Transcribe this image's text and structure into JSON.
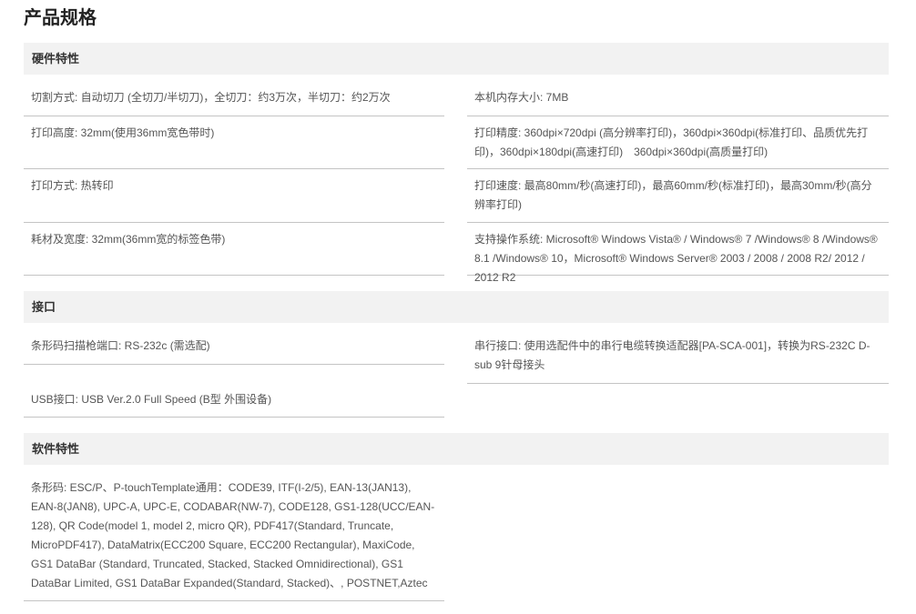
{
  "page_title": "产品规格",
  "sections": [
    {
      "title": "硬件特性",
      "left": [
        "切割方式: 自动切刀 (全切刀/半切刀)，全切刀：约3万次，半切刀：约2万次",
        "打印高度: 32mm(使用36mm宽色带时)",
        "打印方式: 热转印",
        "耗材及宽度: 32mm(36mm宽的标签色带)"
      ],
      "right": [
        "本机内存大小: 7MB",
        "打印精度: 360dpi×720dpi (高分辨率打印)，360dpi×360dpi(标准打印、品质优先打印)，360dpi×180dpi(高速打印)　360dpi×360dpi(高质量打印)",
        "打印速度: 最高80mm/秒(高速打印)，最高60mm/秒(标准打印)，最高30mm/秒(高分辨率打印)",
        "支持操作系统: Microsoft® Windows Vista® / Windows® 7 /Windows® 8 /Windows® 8.1 /Windows® 10，Microsoft® Windows Server® 2003 / 2008 / 2008 R2/ 2012 / 2012 R2"
      ]
    },
    {
      "title": "接口",
      "left": [
        "条形码扫描枪端口: RS-232c (需选配)",
        "USB接口: USB Ver.2.0 Full Speed (B型 外围设备)"
      ],
      "right": [
        "串行接口: 使用选配件中的串行电缆转换适配器[PA-SCA-001]，转换为RS-232C D-sub 9针母接头"
      ]
    },
    {
      "title": "软件特性",
      "left": [
        "条形码: ESC/P、P-touchTemplate通用：CODE39, ITF(I-2/5), EAN-13(JAN13), EAN-8(JAN8), UPC-A, UPC-E, CODABAR(NW-7), CODE128, GS1-128(UCC/EAN-128), QR Code(model 1, model 2, micro QR), PDF417(Standard, Truncate, MicroPDF417), DataMatrix(ECC200 Square, ECC200 Rectangular), MaxiCode, GS1 DataBar (Standard, Truncated, Stacked, Stacked Omnidirectional), GS1 DataBar Limited, GS1 DataBar Expanded(Standard, Stacked)、, POSTNET,Aztec"
      ]
    }
  ]
}
